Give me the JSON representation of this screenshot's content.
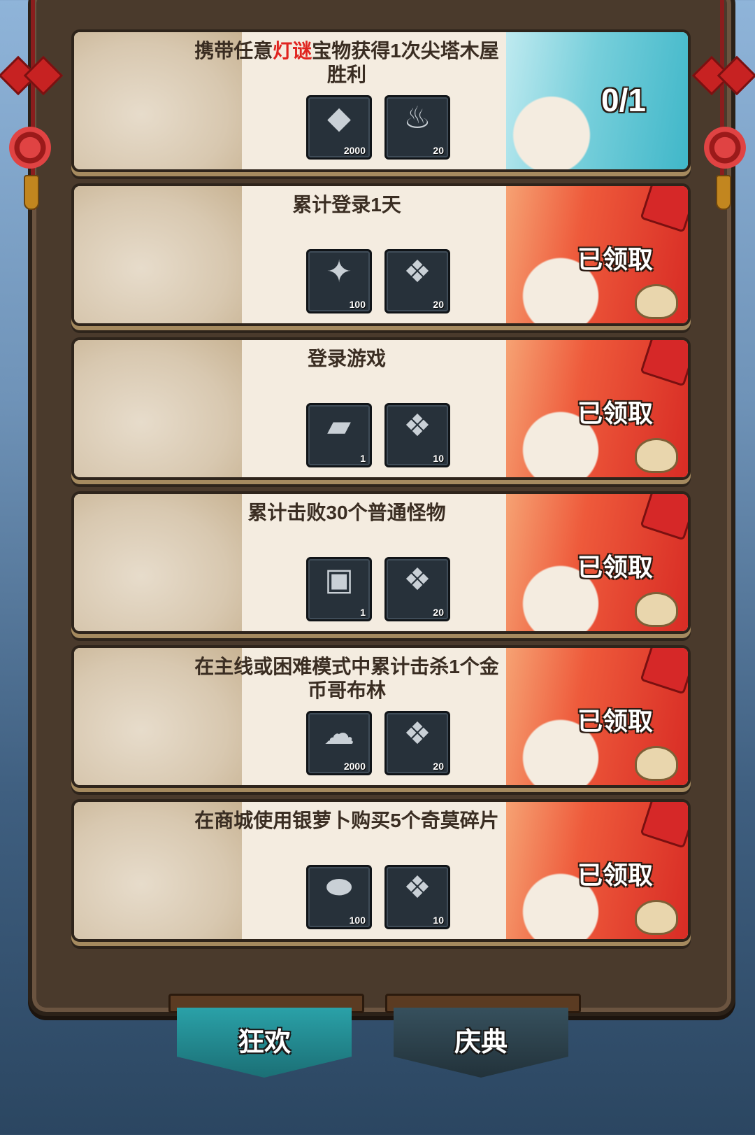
{
  "tasks": [
    {
      "title_parts": [
        "携带任意",
        "灯谜",
        "宝物获得1次尖塔木屋胜利"
      ],
      "status": "0/1",
      "status_type": "progress",
      "side_color": "blue",
      "rewards": [
        {
          "icon": "blue-crystal-icon",
          "qty": "2000",
          "glyph": "◆"
        },
        {
          "icon": "flame-torch-icon",
          "qty": "20",
          "glyph": "♨"
        }
      ]
    },
    {
      "title": "累计登录1天",
      "status": "已领取",
      "status_type": "claimed",
      "side_color": "red",
      "rewards": [
        {
          "icon": "silver-radish-icon",
          "qty": "100",
          "glyph": "✦"
        },
        {
          "icon": "chinese-knot-icon",
          "qty": "20",
          "glyph": "❖"
        }
      ]
    },
    {
      "title": "登录游戏",
      "status": "已领取",
      "status_type": "claimed",
      "side_color": "red",
      "rewards": [
        {
          "icon": "stone-tablet-icon",
          "qty": "1",
          "glyph": "▰"
        },
        {
          "icon": "chinese-knot-icon",
          "qty": "10",
          "glyph": "❖"
        }
      ]
    },
    {
      "title": "累计击败30个普通怪物",
      "status": "已领取",
      "status_type": "claimed",
      "side_color": "red",
      "rewards": [
        {
          "icon": "treasure-chest-icon",
          "qty": "1",
          "glyph": "▣"
        },
        {
          "icon": "chinese-knot-icon",
          "qty": "20",
          "glyph": "❖"
        }
      ]
    },
    {
      "title": "在主线或困难模式中累计击杀1个金币哥布林",
      "status": "已领取",
      "status_type": "claimed",
      "side_color": "red",
      "rewards": [
        {
          "icon": "silver-feather-icon",
          "qty": "2000",
          "glyph": "☁"
        },
        {
          "icon": "chinese-knot-icon",
          "qty": "20",
          "glyph": "❖"
        }
      ]
    },
    {
      "title": "在商城使用银萝卜购买5个奇莫碎片",
      "status": "已领取",
      "status_type": "claimed",
      "side_color": "red",
      "rewards": [
        {
          "icon": "silver-bread-icon",
          "qty": "100",
          "glyph": "⬬"
        },
        {
          "icon": "chinese-knot-icon",
          "qty": "10",
          "glyph": "❖"
        }
      ]
    }
  ],
  "tabs": [
    {
      "label": "狂欢",
      "active": true
    },
    {
      "label": "庆典",
      "active": false
    }
  ],
  "colors": {
    "highlight_text": "#e0241f",
    "claimed_red": "#d82c25",
    "progress_teal": "#40b7c9",
    "active_tab": "#2aa1a8",
    "inactive_tab": "#36505d"
  }
}
